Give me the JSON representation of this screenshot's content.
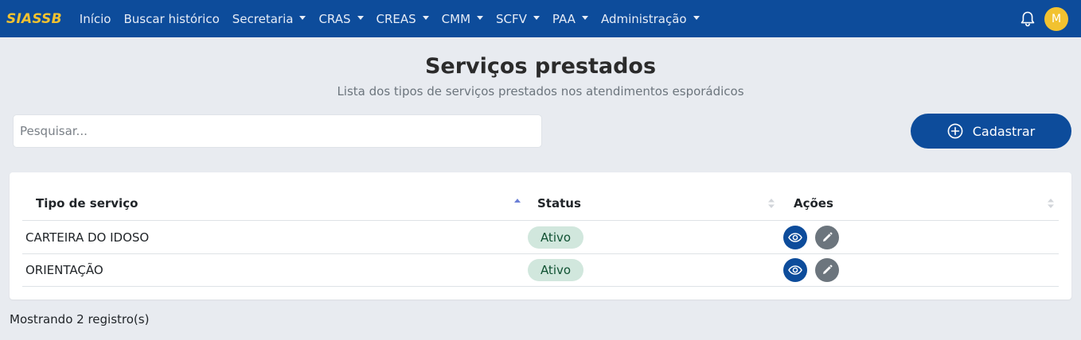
{
  "nav": {
    "brand": "SIASSB",
    "items": [
      {
        "label": "Início",
        "dropdown": false
      },
      {
        "label": "Buscar histórico",
        "dropdown": false
      },
      {
        "label": "Secretaria",
        "dropdown": true
      },
      {
        "label": "CRAS",
        "dropdown": true
      },
      {
        "label": "CREAS",
        "dropdown": true
      },
      {
        "label": "CMM",
        "dropdown": true
      },
      {
        "label": "SCFV",
        "dropdown": true
      },
      {
        "label": "PAA",
        "dropdown": true
      },
      {
        "label": "Administração",
        "dropdown": true
      }
    ],
    "notification_icon": "bell-icon",
    "avatar_initial": "M"
  },
  "page": {
    "title": "Serviços prestados",
    "subtitle": "Lista dos tipos de serviços prestados nos atendimentos esporádicos"
  },
  "search": {
    "placeholder": "Pesquisar...",
    "value": ""
  },
  "cadastrar": {
    "label": "Cadastrar",
    "icon": "plus-circle-icon"
  },
  "table": {
    "columns": [
      {
        "label": "Tipo de serviço",
        "sort": "asc"
      },
      {
        "label": "Status",
        "sort": "none"
      },
      {
        "label": "Ações",
        "sort": "none"
      }
    ],
    "rows": [
      {
        "tipo": "CARTEIRA DO IDOSO",
        "status": "Ativo"
      },
      {
        "tipo": "ORIENTAÇÃO",
        "status": "Ativo"
      }
    ]
  },
  "footer": {
    "count_text": "Mostrando 2 registro(s)"
  },
  "colors": {
    "primary": "#0d4c9b",
    "brand_yellow": "#f2c230",
    "badge_bg": "#d1e7dd",
    "badge_text": "#0f5132",
    "edit_button": "#6c757d",
    "sort_active": "#6b7fd6"
  }
}
